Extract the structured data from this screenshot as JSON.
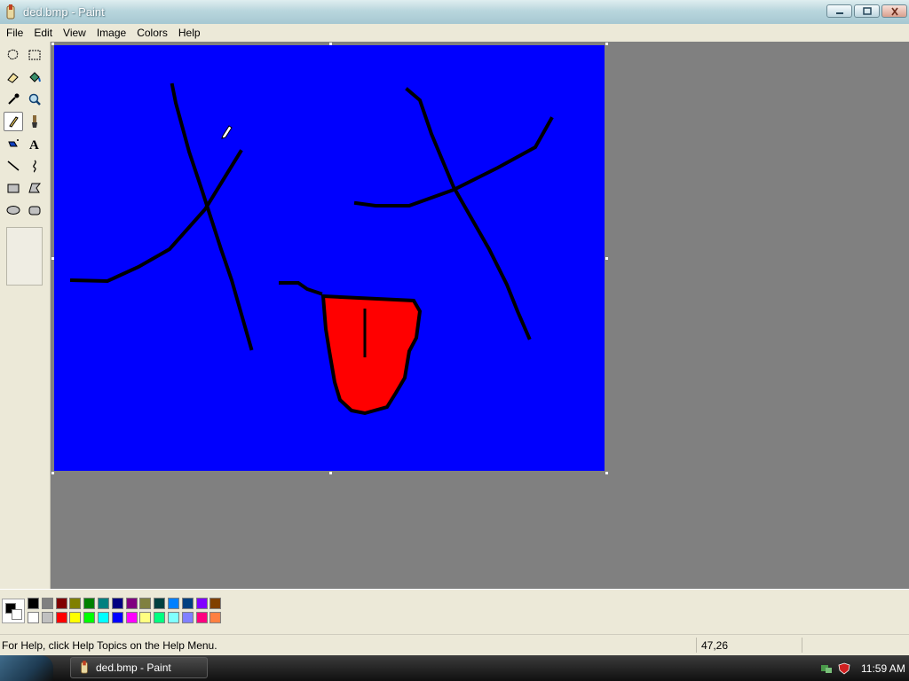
{
  "window": {
    "title": "ded.bmp - Paint"
  },
  "menu": {
    "items": [
      "File",
      "Edit",
      "View",
      "Image",
      "Colors",
      "Help"
    ]
  },
  "toolbox": {
    "tools": [
      "free-form-select",
      "select",
      "eraser",
      "fill-with-color",
      "pick-color",
      "magnifier",
      "pencil",
      "brush",
      "airbrush",
      "text",
      "line",
      "curve",
      "rectangle",
      "polygon",
      "ellipse",
      "rounded-rectangle"
    ],
    "active_tool": "pencil"
  },
  "canvas": {
    "background": "#0000fe",
    "stroke_color": "#000000",
    "fill_color": "#ff0000"
  },
  "palette": {
    "foreground": "#000000",
    "background": "#ffffff",
    "colors": [
      [
        "#000000",
        "#808080",
        "#800000",
        "#808000",
        "#008000",
        "#008080",
        "#000080",
        "#800080",
        "#808040",
        "#004040",
        "#0080ff",
        "#004080",
        "#8000ff",
        "#804000"
      ],
      [
        "#ffffff",
        "#c0c0c0",
        "#ff0000",
        "#ffff00",
        "#00ff00",
        "#00ffff",
        "#0000ff",
        "#ff00ff",
        "#ffff80",
        "#00ff80",
        "#80ffff",
        "#8080ff",
        "#ff0080",
        "#ff8040"
      ]
    ]
  },
  "status": {
    "help_text": "For Help, click Help Topics on the Help Menu.",
    "coords": "47,26"
  },
  "taskbar": {
    "task_label": "ded.bmp - Paint",
    "clock": "11:59 AM"
  }
}
